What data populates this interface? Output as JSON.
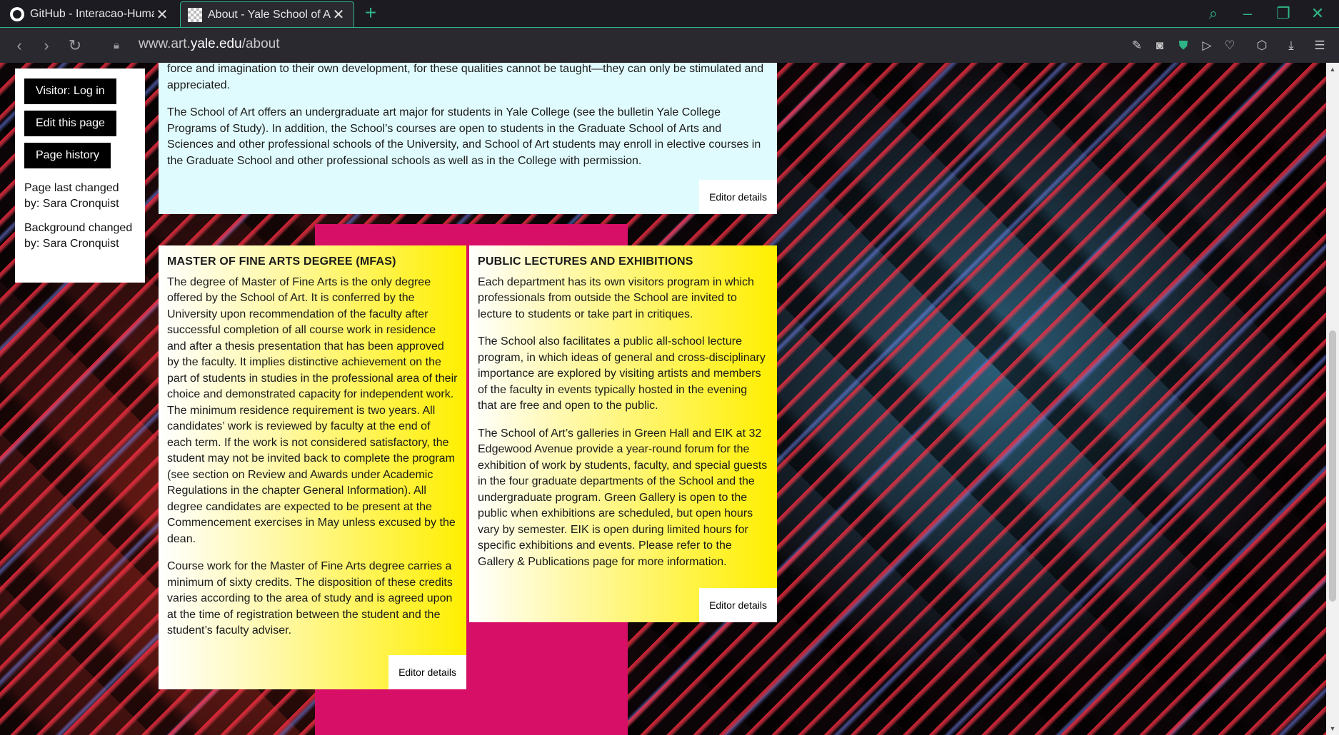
{
  "browser": {
    "tabs": [
      {
        "title": "GitHub - Interacao-Human",
        "favicon": "github-icon"
      },
      {
        "title": "About - Yale School of Art",
        "favicon": "yale-favicon",
        "active": true
      }
    ],
    "url_prefix": "www.art.",
    "url_domain": "yale.edu",
    "url_path": "/about",
    "accent_color": "#2fb585"
  },
  "sidebar": {
    "login_label": "Visitor: Log in",
    "edit_label": "Edit this page",
    "history_label": "Page history",
    "last_changed": "Page last changed by: Sara Cronquist",
    "background_changed": "Background changed by: Sara Cronquist"
  },
  "card_top": {
    "p1": "force and imagination to their own development, for these qualities cannot be taught—they can only be stimulated and appreciated.",
    "p2": "The School of Art offers an undergraduate art major for students in Yale College (see the bulletin Yale College Programs of Study). In addition, the School’s courses are open to students in the Graduate School of Arts and Sciences and other professional schools of the University, and School of Art students may enroll in elective courses in the Graduate School and other professional schools as well as in the College with permission.",
    "editor_label": "Editor details"
  },
  "card_mfa": {
    "heading": "MASTER OF FINE ARTS DEGREE (MFAS)",
    "p1": "The degree of Master of Fine Arts is the only degree offered by the School of Art. It is conferred by the University upon recommendation of the faculty after successful completion of all course work in residence and after a thesis presentation that has been approved by the faculty. It implies distinctive achievement on the part of students in studies in the professional area of their choice and demonstrated capacity for independent work. The minimum residence requirement is two years. All candidates’ work is reviewed by faculty at the end of each term. If the work is not considered satisfactory, the student may not be invited back to complete the program (see section on Review and Awards under Academic Regulations in the chapter General Information). All degree candidates are expected to be present at the Commencement exercises in May unless excused by the dean.",
    "p2": "Course work for the Master of Fine Arts degree carries a minimum of sixty credits. The disposition of these credits varies according to the area of study and is agreed upon at the time of registration between the student and the student’s faculty adviser.",
    "editor_label": "Editor details"
  },
  "card_lectures": {
    "heading": "PUBLIC LECTURES AND EXHIBITIONS",
    "p1": "Each department has its own visitors program in which professionals from outside the School are invited to lecture to students or take part in critiques.",
    "p2": "The School also facilitates a public all-school lecture program, in which ideas of general and cross-disciplinary importance are explored by visiting artists and members of the faculty in events typically hosted in the evening that are free and open to the public.",
    "p3": "The School of Art’s galleries in Green Hall and EIK at 32 Edgewood Avenue provide a year-round forum for the exhibition of work by students, faculty, and special guests in the four graduate departments of the School and the undergraduate program. Green Gallery is open to the public when exhibitions are scheduled, but open hours vary by semester. EIK is open during limited hours for specific exhibitions and events. Please refer to the Gallery & Publications page for more information.",
    "editor_label": "Editor details"
  },
  "colors": {
    "top_card_bg": "#e0fbfe",
    "yellow_card": "#ffef00",
    "magenta_strip": "#d80f67"
  }
}
